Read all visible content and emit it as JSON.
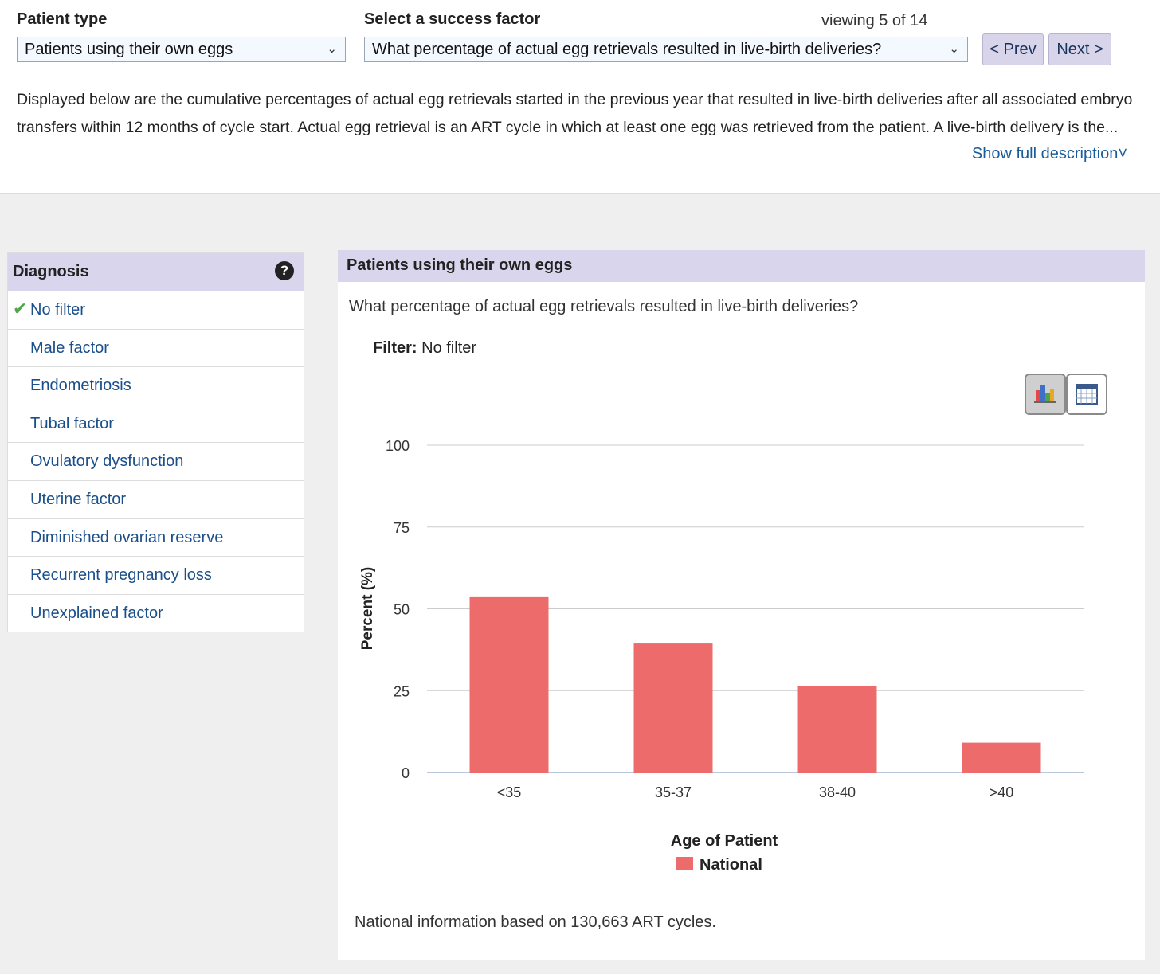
{
  "filters": {
    "patient_type_label": "Patient type",
    "patient_type_value": "Patients using their own eggs",
    "success_factor_label": "Select a success factor",
    "success_factor_value": "What percentage of actual egg retrievals resulted in live-birth deliveries?",
    "viewing": "viewing 5 of 14",
    "prev_label": "< Prev",
    "next_label": "Next >"
  },
  "description": {
    "line1": "Displayed below are the cumulative percentages of actual egg retrievals started in the previous year that resulted in live-birth deliveries after all associated embryo",
    "line2": "transfers within 12 months of cycle start. Actual egg retrieval is an ART cycle in which at least one egg was retrieved from the patient. A live-birth delivery is the...",
    "show_full": "Show full description˅"
  },
  "sidebar": {
    "title": "Diagnosis",
    "help_icon": "?",
    "selected_icon": "✔",
    "items": [
      {
        "label": "No filter",
        "selected": true
      },
      {
        "label": "Male factor"
      },
      {
        "label": "Endometriosis"
      },
      {
        "label": "Tubal factor"
      },
      {
        "label": "Ovulatory dysfunction"
      },
      {
        "label": "Uterine factor"
      },
      {
        "label": "Diminished ovarian reserve"
      },
      {
        "label": "Recurrent pregnancy loss"
      },
      {
        "label": "Unexplained factor"
      }
    ]
  },
  "panel": {
    "title": "Patients using their own eggs",
    "question": "What percentage of actual egg retrievals resulted in live-birth deliveries?",
    "filter_label": "Filter:",
    "filter_value": "No filter",
    "note": "National information based on 130,663 ART cycles."
  },
  "view_toggle": {
    "active": "bar-chart-icon",
    "other": "table-icon"
  },
  "colors": {
    "bar": "#ee6b6c",
    "header": "#d9d5ec",
    "link": "#1a4f8b"
  },
  "chart_data": {
    "type": "bar",
    "categories": [
      "<35",
      "35-37",
      "38-40",
      ">40"
    ],
    "series": [
      {
        "name": "National",
        "values": [
          53.8,
          39.4,
          26.3,
          9.1
        ]
      }
    ],
    "ylabel": "Percent (%)",
    "xlabel": "Age of Patient",
    "ylim": [
      0,
      100
    ],
    "yticks": [
      0,
      25,
      50,
      75,
      100
    ],
    "grid": true,
    "legend": "bottom"
  }
}
